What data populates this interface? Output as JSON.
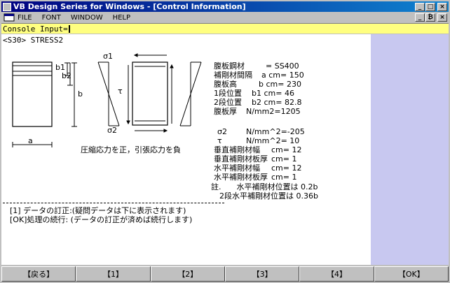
{
  "window": {
    "title": "VB Design Series for Windows - [Control Information]"
  },
  "title_buttons": [
    "_",
    "□",
    "×"
  ],
  "menu": {
    "items": [
      "FILE",
      "FONT",
      "WINDOW",
      "HELP"
    ],
    "child_buttons": [
      "_",
      "₿",
      "×"
    ]
  },
  "console": {
    "label": "Console Input="
  },
  "screen": {
    "header": "<S30> STRESS2",
    "diagram": {
      "sigma1": "σ1",
      "sigma2": "σ2",
      "tau": "τ",
      "b1": "b1",
      "b2": "b2",
      "b": "b",
      "a": "a",
      "caption": "圧縮応力を正，引張応力を負"
    },
    "params": [
      {
        "label": "腹板鋼材",
        "value": "　　= SS400"
      },
      {
        "label": "補剛材間隔",
        "value": "a cm= 150"
      },
      {
        "label": "腹板高",
        "value": "　　b cm= 230"
      },
      {
        "label": "1段位置",
        "value": "b1 cm= 46"
      },
      {
        "label": "2段位置",
        "value": "b2 cm= 82.8"
      },
      {
        "label": "腹板厚",
        "value": "N/mm2=1205"
      }
    ],
    "stress": [
      {
        "label": "σ2",
        "value": "N/mm^2=-205"
      },
      {
        "label": "τ",
        "value": "N/mm^2= 10"
      }
    ],
    "results": [
      {
        "label": "垂直補剛材幅",
        "value": "cm= 12"
      },
      {
        "label": "垂直補剛材板厚",
        "value": "cm= 1"
      },
      {
        "label": "水平補剛材幅",
        "value": "cm= 12"
      },
      {
        "label": "水平補剛材板厚",
        "value": "cm= 1"
      }
    ],
    "notes": [
      "註.　　水平補剛材位置は 0.2b",
      "2段水平補剛材位置は 0.36b"
    ],
    "messages": [
      "[1] データの訂正:(疑問データは下に表示されます)",
      "[OK]処理の続行: (データの訂正が済めば続行します)"
    ]
  },
  "function_buttons": [
    "【戻る】",
    "【1】",
    "【2】",
    "【3】",
    "【4】",
    "【OK】"
  ],
  "colors": {
    "titlebar": "#000080",
    "console_bg": "#ffff80",
    "side_panel": "#c8c8f0"
  }
}
